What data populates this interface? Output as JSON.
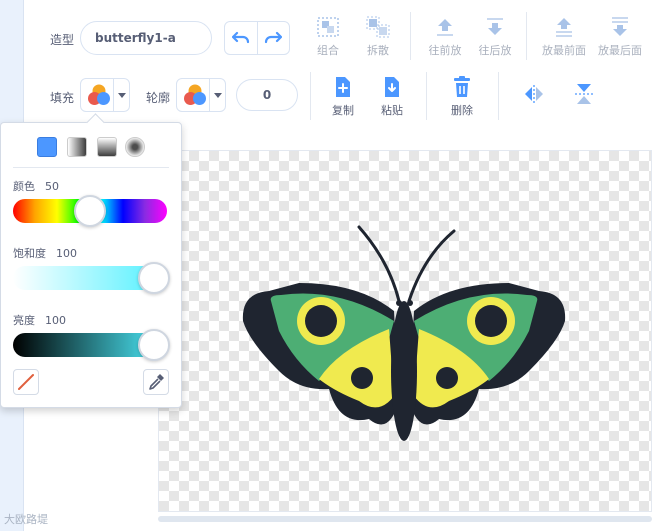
{
  "toolbar": {
    "costume_label": "造型",
    "costume_name": "butterfly1-a",
    "fill_label": "填充",
    "outline_label": "轮廓",
    "outline_width": "0",
    "tools_row1": {
      "group": "组合",
      "ungroup": "拆散",
      "forward": "往前放",
      "backward": "往后放",
      "front": "放最前面",
      "back": "放最后面"
    },
    "tools_row2": {
      "copy": "复制",
      "paste": "粘贴",
      "delete": "删除"
    }
  },
  "color_popup": {
    "color_label": "颜色",
    "color_value": "50",
    "saturation_label": "饱和度",
    "saturation_value": "100",
    "brightness_label": "亮度",
    "brightness_value": "100",
    "fill_modes": [
      "solid",
      "horizontal-gradient",
      "vertical-gradient",
      "radial-gradient"
    ],
    "selected_fill_mode": "solid"
  },
  "colors": {
    "accent": "#4c97ff",
    "butterfly_green": "#4dae74",
    "butterfly_yellow": "#f0ea4f",
    "butterfly_dark": "#1f2530"
  },
  "watermark": "大欧路堤"
}
